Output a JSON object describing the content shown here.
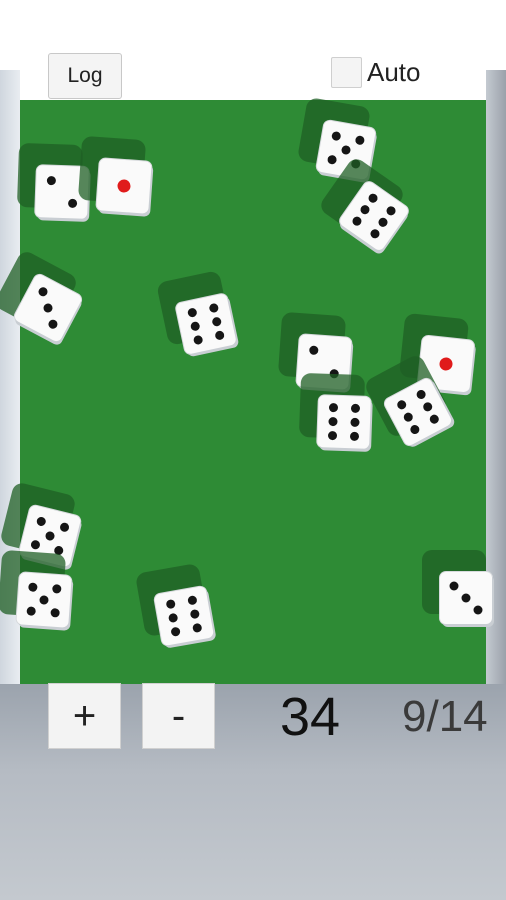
{
  "top_bar": {
    "log_label": "Log",
    "auto_label": "Auto",
    "auto_checked": false
  },
  "bottom_bar": {
    "plus_label": "+",
    "minus_label": "-",
    "total": "34",
    "dice_count": "9/14"
  },
  "colors": {
    "felt": "#2e8b35",
    "pip": "#151515",
    "one_pip": "#e01b1b"
  },
  "dice_faces": [
    2,
    1,
    5,
    6,
    3,
    6,
    2,
    6,
    1,
    6,
    5,
    5,
    6,
    3
  ]
}
